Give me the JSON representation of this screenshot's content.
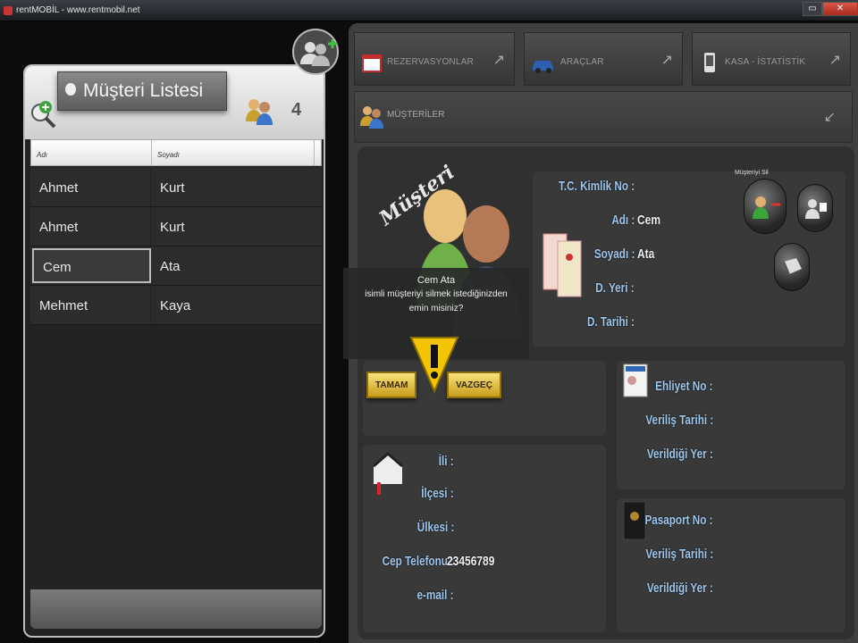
{
  "window": {
    "title": "rentMOBİL - www.rentmobil.net",
    "buttons": [
      "▭",
      "✕"
    ]
  },
  "left": {
    "title": "Müşteri Listesi",
    "count": "4",
    "columns": [
      "Adı",
      "Soyadı"
    ],
    "rows": [
      {
        "ad": "Ahmet",
        "soyad": "Kurt"
      },
      {
        "ad": "Ahmet",
        "soyad": "Kurt"
      },
      {
        "ad": "Cem",
        "soyad": "Ata"
      },
      {
        "ad": "Mehmet",
        "soyad": "Kaya"
      }
    ],
    "selected_index": 2
  },
  "tabs": [
    {
      "label": "REZERVASYONLAR",
      "icon": "calendar-icon",
      "arrow": "↗"
    },
    {
      "label": "ARAÇLAR",
      "icon": "car-icon",
      "arrow": "↗"
    },
    {
      "label": "KASA - İSTATİSTİK",
      "icon": "phone-icon",
      "arrow": "↗"
    }
  ],
  "musteriler": {
    "label": "MÜŞTERİLER",
    "arrow": "↙"
  },
  "form": {
    "section_title": "Müşteri",
    "sil_label": "Müşteriyi Sil",
    "kimlik": {
      "tc_label": "T.C. Kimlik No :",
      "adi_label": "Adı :",
      "adi_value": "Cem",
      "soyadi_label": "Soyadı :",
      "soyadi_value": "Ata",
      "dyeri_label": "D. Yeri :",
      "dtarihi_label": "D. Tarihi :"
    },
    "ehliyet": {
      "no_label": "Ehliyet No :",
      "verilis_label": "Veriliş Tarihi :",
      "verildigi_label": "Verildiği Yer :"
    },
    "adres": {
      "il_label": "İli :",
      "ilce_label": "İlçesi :",
      "ulke_label": "Ülkesi :",
      "cep_label": "Cep Telefonu :",
      "cep_value": "23456789",
      "email_label": "e-mail :"
    },
    "pasaport": {
      "no_label": "Pasaport No :",
      "verilis_label": "Veriliş Tarihi :",
      "verildigi_label": "Verildiği Yer :"
    }
  },
  "dialog": {
    "name": "Cem Ata",
    "line1": "isimli müşteriyi silmek istediğinizden",
    "line2": "emin misiniz?",
    "ok": "TAMAM",
    "cancel": "VAZGEÇ"
  },
  "colors": {
    "label_blue": "#9ec7ee",
    "button_yellow": "#f0cf4a",
    "warning_yellow": "#f5c400"
  }
}
